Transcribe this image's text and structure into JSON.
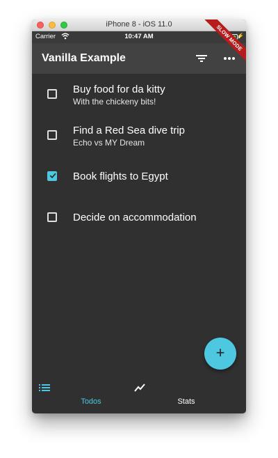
{
  "window": {
    "title": "iPhone 8 - iOS 11.0"
  },
  "status_bar": {
    "carrier": "Carrier",
    "time": "10:47 AM"
  },
  "app_bar": {
    "title": "Vanilla Example",
    "actions": [
      "filter-icon",
      "more-horiz-icon"
    ]
  },
  "debug_banner": "SLOW MODE",
  "todos": [
    {
      "title": "Buy food for da kitty",
      "note": "With the chickeny bits!",
      "complete": false
    },
    {
      "title": "Find a Red Sea dive trip",
      "note": "Echo vs MY Dream",
      "complete": false
    },
    {
      "title": "Book flights to Egypt",
      "note": "",
      "complete": true
    },
    {
      "title": "Decide on accommodation",
      "note": "",
      "complete": false
    }
  ],
  "fab": {
    "icon": "+"
  },
  "bottom_nav": {
    "todos_label": "Todos",
    "stats_label": "Stats",
    "active": "todos"
  },
  "colors": {
    "accent": "#4dc8e0",
    "background": "#303030",
    "app_bar": "#424242",
    "banner": "#b71c1c"
  }
}
